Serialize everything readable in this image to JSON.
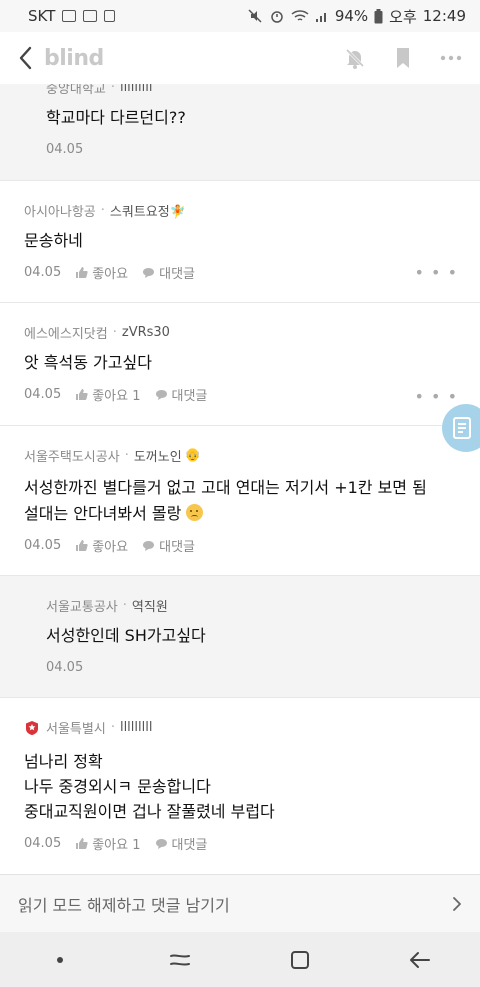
{
  "status_bar": {
    "carrier": "SKT",
    "battery": "94%",
    "ampm": "오후",
    "time": "12:49"
  },
  "header": {
    "logo": "blind"
  },
  "comments": [
    {
      "company": "중앙대학교",
      "nick": "lllllllll",
      "text": "학교마다 다르던디??",
      "date": "04.05"
    },
    {
      "company": "아시아나항공",
      "nick": "스쿼트요정🧚",
      "text": "문송하네",
      "date": "04.05",
      "like": "좋아요",
      "reply": "대댓글"
    },
    {
      "company": "에스에스지닷컴",
      "nick": "zVRs30",
      "text": "앗 흑석동 가고싶다",
      "date": "04.05",
      "like": "좋아요 1",
      "reply": "대댓글"
    },
    {
      "company": "서울주택도시공사",
      "nick": "도꺼노인",
      "text_line1": "서성한까진 별다를거 없고 고대 연대는 저기서 +1칸 보면 됨",
      "text_line2": "설대는 안다녀봐서 몰랑",
      "date": "04.05",
      "like": "좋아요",
      "reply": "대댓글"
    },
    {
      "company": "서울교통공사",
      "nick": "역직원",
      "text": "서성한인데 SH가고싶다",
      "date": "04.05"
    },
    {
      "company": "서울특별시",
      "nick": "lllllllll",
      "text_line1": "넘나리 정확",
      "text_line2": "나두 중경외시ㅋ 문송합니다",
      "text_line3": "중대교직원이면 겁나 잘풀렸네 부럽다",
      "date": "04.05",
      "like": "좋아요 1",
      "reply": "대댓글"
    }
  ],
  "read_bar": {
    "label": "읽기 모드 해제하고 댓글 남기기"
  },
  "more_label": "• • •",
  "colors": {
    "accent_red": "#d8343a",
    "float_blue": "#a7d3ea"
  }
}
